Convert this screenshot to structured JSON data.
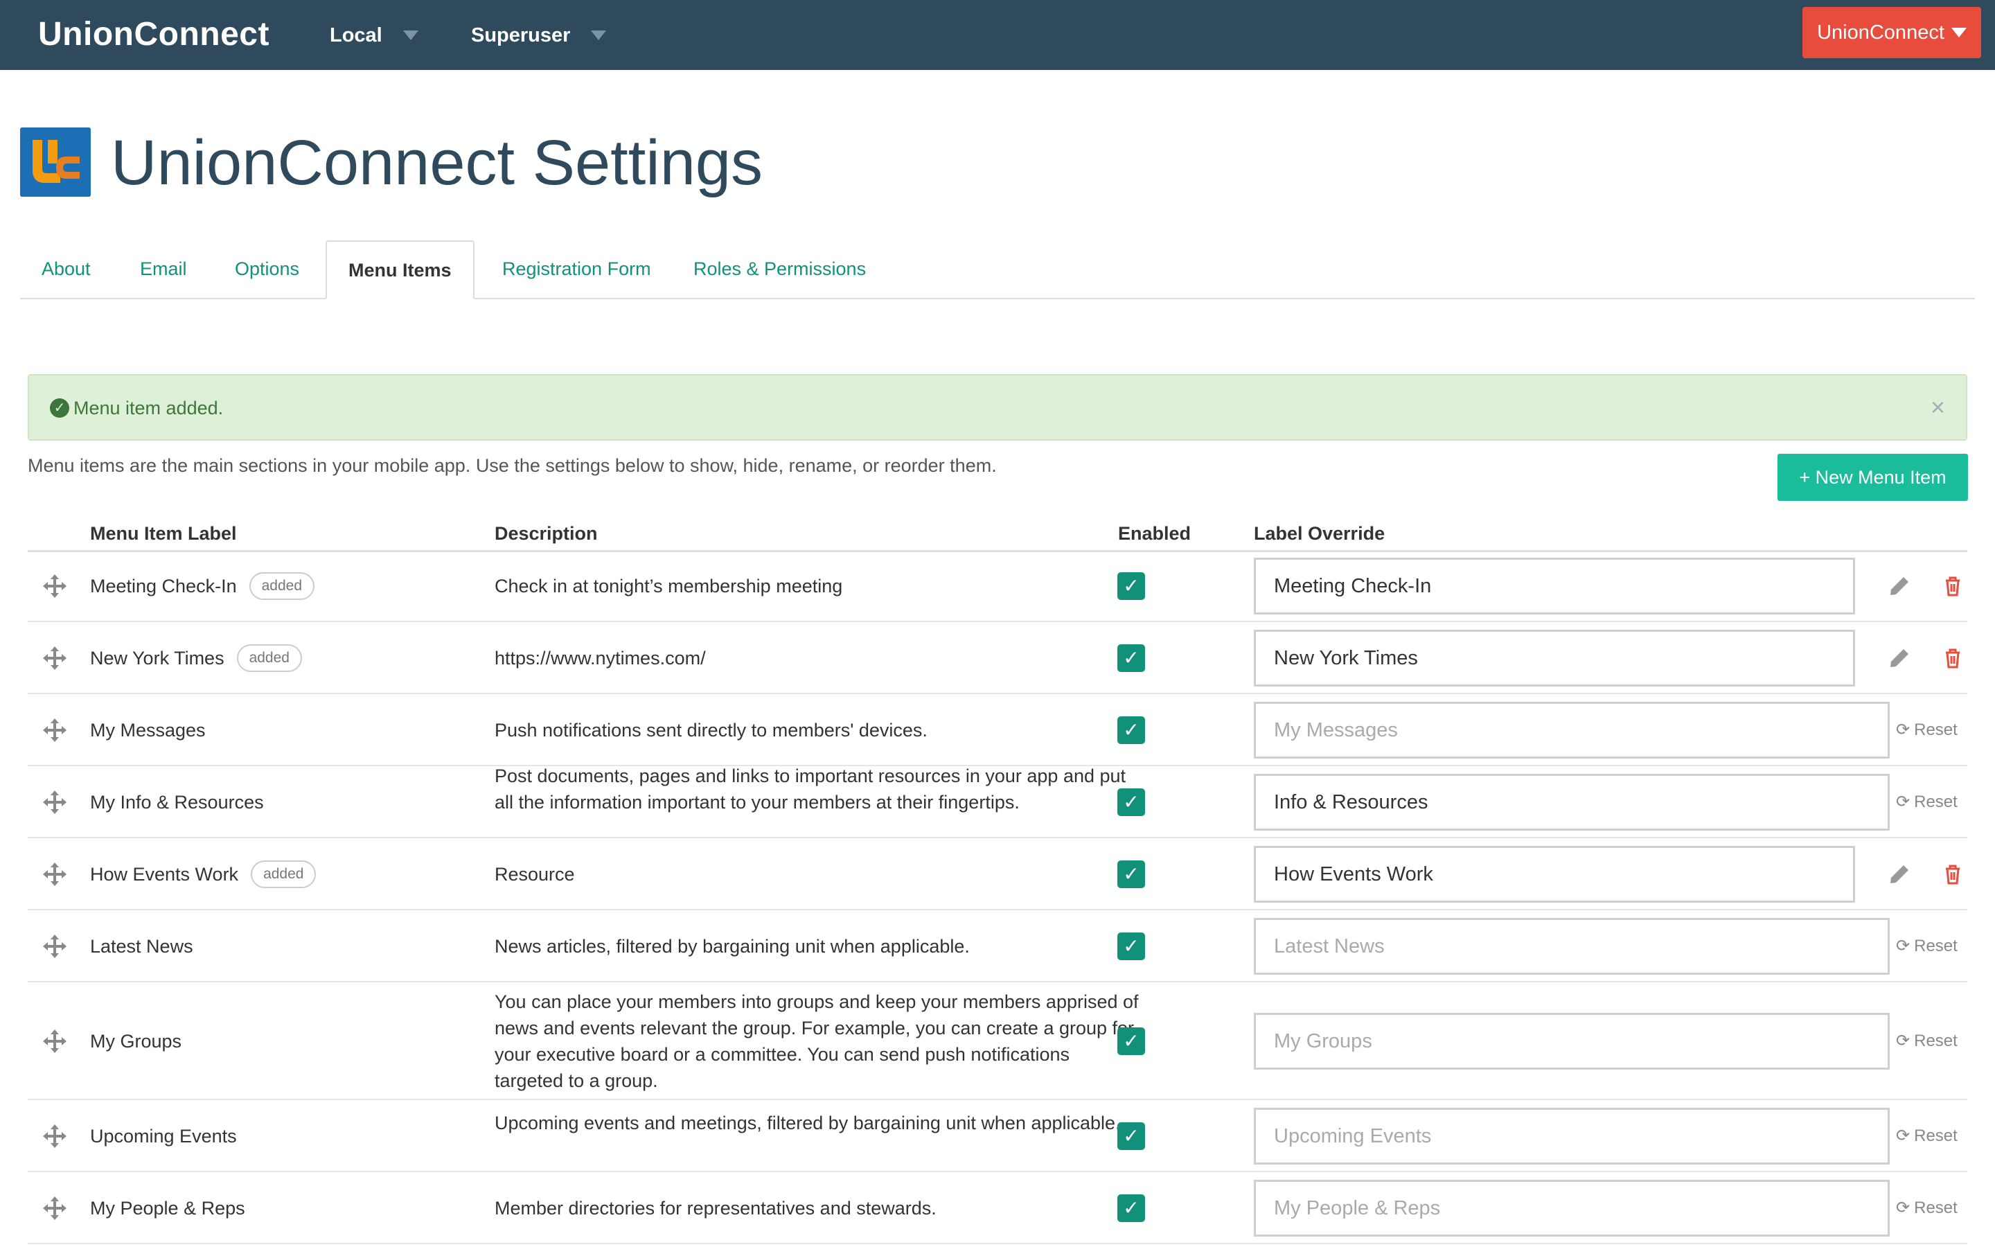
{
  "topbar": {
    "brand": "UnionConnect",
    "nav": [
      {
        "label": "Local"
      },
      {
        "label": "Superuser"
      }
    ],
    "account_button": "UnionConnect"
  },
  "header": {
    "title": "UnionConnect Settings"
  },
  "tabs": [
    {
      "label": "About"
    },
    {
      "label": "Email"
    },
    {
      "label": "Options"
    },
    {
      "label": "Menu Items",
      "active": true
    },
    {
      "label": "Registration Form"
    },
    {
      "label": "Roles & Permissions"
    }
  ],
  "alert": {
    "text": "Menu item added.",
    "close": "×"
  },
  "intro": "Menu items are the main sections in your mobile app. Use the settings below to show, hide, rename, or reorder them.",
  "new_button": "+ New Menu Item",
  "table": {
    "headers": {
      "label": "Menu Item Label",
      "description": "Description",
      "enabled": "Enabled",
      "override": "Label Override"
    },
    "reset_label": "Reset",
    "rows": [
      {
        "label": "Meeting Check-In",
        "badge": "added",
        "description": "Check in at tonight’s membership meeting",
        "enabled": true,
        "override_value": "Meeting Check-In",
        "placeholder": false,
        "action": "edit-delete"
      },
      {
        "label": "New York Times",
        "badge": "added",
        "description": "https://www.nytimes.com/",
        "enabled": true,
        "override_value": "New York Times",
        "placeholder": false,
        "action": "edit-delete"
      },
      {
        "label": "My Messages",
        "badge": "",
        "description": "Push notifications sent directly to members' devices.",
        "enabled": true,
        "override_value": "My Messages",
        "placeholder": true,
        "action": "reset"
      },
      {
        "label": "My Info & Resources",
        "badge": "",
        "description": "Post documents, pages and links to important resources in your app and put all the information important to your members at their fingertips.",
        "enabled": true,
        "override_value": "Info & Resources",
        "placeholder": false,
        "action": "reset"
      },
      {
        "label": "How Events Work",
        "badge": "added",
        "description": "Resource",
        "enabled": true,
        "override_value": "How Events Work",
        "placeholder": false,
        "action": "edit-delete"
      },
      {
        "label": "Latest News",
        "badge": "",
        "description": "News articles, filtered by bargaining unit when applicable.",
        "enabled": true,
        "override_value": "Latest News",
        "placeholder": true,
        "action": "reset"
      },
      {
        "label": "My Groups",
        "badge": "",
        "description": "You can place your members into groups and keep your members apprised of news and events relevant the group. For example, you can create a group for your executive board or a committee. You can send push notifications targeted to a group.",
        "enabled": true,
        "override_value": "My Groups",
        "placeholder": true,
        "action": "reset"
      },
      {
        "label": "Upcoming Events",
        "badge": "",
        "description": "Upcoming events and meetings, filtered by bargaining unit when applicable.",
        "enabled": true,
        "override_value": "Upcoming Events",
        "placeholder": true,
        "action": "reset"
      },
      {
        "label": "My People & Reps",
        "badge": "",
        "description": "Member directories for representatives and stewards.",
        "enabled": true,
        "override_value": "My People & Reps",
        "placeholder": true,
        "action": "reset"
      }
    ]
  }
}
